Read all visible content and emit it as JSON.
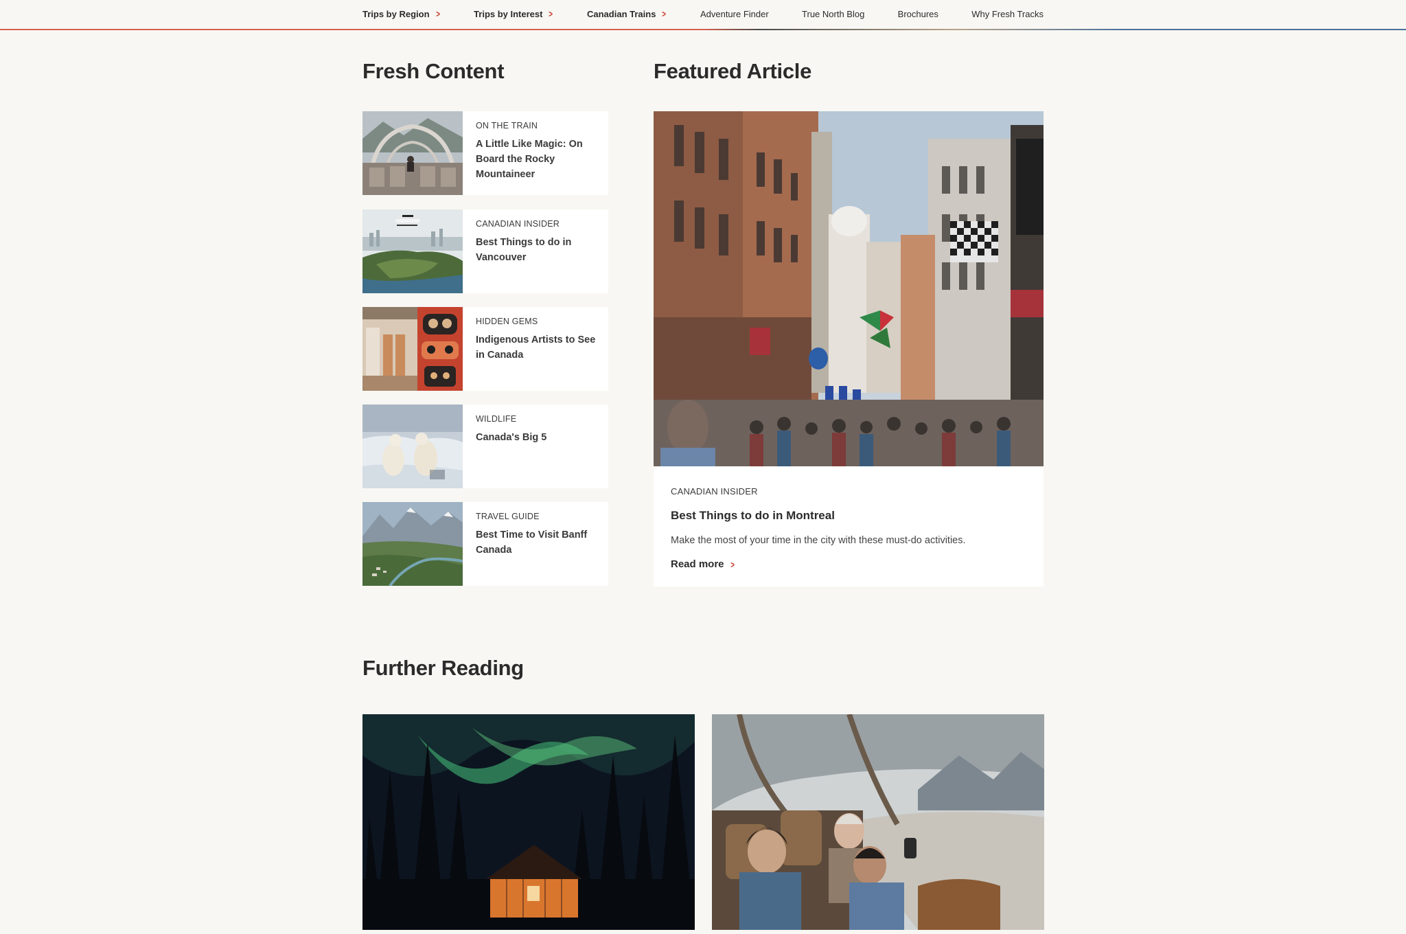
{
  "nav": {
    "items": [
      {
        "label": "Trips by Region",
        "has_arrow": true
      },
      {
        "label": "Trips by Interest",
        "has_arrow": true
      },
      {
        "label": "Canadian Trains",
        "has_arrow": true
      },
      {
        "label": "Adventure Finder",
        "has_arrow": false
      },
      {
        "label": "True North Blog",
        "has_arrow": false
      },
      {
        "label": "Brochures",
        "has_arrow": false
      },
      {
        "label": "Why Fresh Tracks",
        "has_arrow": false
      }
    ]
  },
  "fresh_content": {
    "heading": "Fresh Content",
    "items": [
      {
        "category": "ON THE TRAIN",
        "title": "A Little Like Magic: On Board the Rocky Mountaineer"
      },
      {
        "category": "CANADIAN INSIDER",
        "title": "Best Things to do in Vancouver"
      },
      {
        "category": "HIDDEN GEMS",
        "title": "Indigenous Artists to See in Canada"
      },
      {
        "category": "WILDLIFE",
        "title": "Canada's Big 5"
      },
      {
        "category": "TRAVEL GUIDE",
        "title": "Best Time to Visit Banff Canada"
      }
    ]
  },
  "featured": {
    "heading": "Featured Article",
    "category": "CANADIAN INSIDER",
    "title": "Best Things to do in Montreal",
    "description": "Make the most of your time in the city with these must-do activities.",
    "read_more": "Read more"
  },
  "further_reading": {
    "heading": "Further Reading"
  },
  "colors": {
    "accent": "#c73c2c",
    "background": "#f8f7f3",
    "text": "#2b2b2b"
  }
}
